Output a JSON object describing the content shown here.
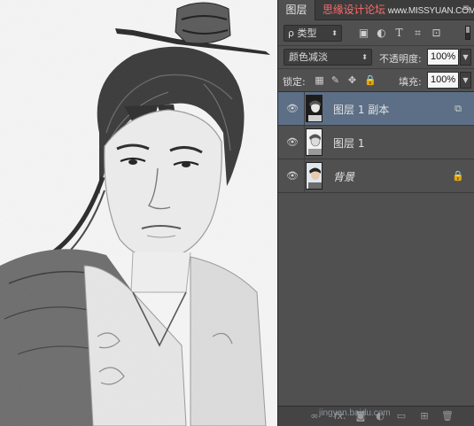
{
  "panel": {
    "tab_label": "图层",
    "watermark_cn": "思缘设计论坛",
    "watermark_url": "www.MISSYUAN.COM",
    "menu_icon": "panel-menu-icon"
  },
  "filter": {
    "select_value": "ρ 类型",
    "icons": [
      "image-filter-icon",
      "adjustment-filter-icon",
      "type-filter-icon",
      "shape-filter-icon",
      "smart-object-filter-icon"
    ]
  },
  "blend": {
    "mode": "颜色减淡",
    "opacity_label": "不透明度:",
    "opacity_value": "100%"
  },
  "lock": {
    "label": "锁定:",
    "fill_label": "填充:",
    "fill_value": "100%"
  },
  "layers": [
    {
      "name": "图层 1 副本",
      "selected": true,
      "visible": true,
      "badge": "blend-clip-icon"
    },
    {
      "name": "图层 1",
      "selected": false,
      "visible": true,
      "badge": ""
    },
    {
      "name": "背景",
      "selected": false,
      "visible": true,
      "badge": "lock-icon"
    }
  ],
  "bottom_bar": {
    "fx_label": "fx.",
    "watermark": "jingyan.baidu.com"
  },
  "colors": {
    "panel_bg": "#505050",
    "selected_row": "#5c6f86",
    "watermark_red": "#ff6a6a"
  }
}
